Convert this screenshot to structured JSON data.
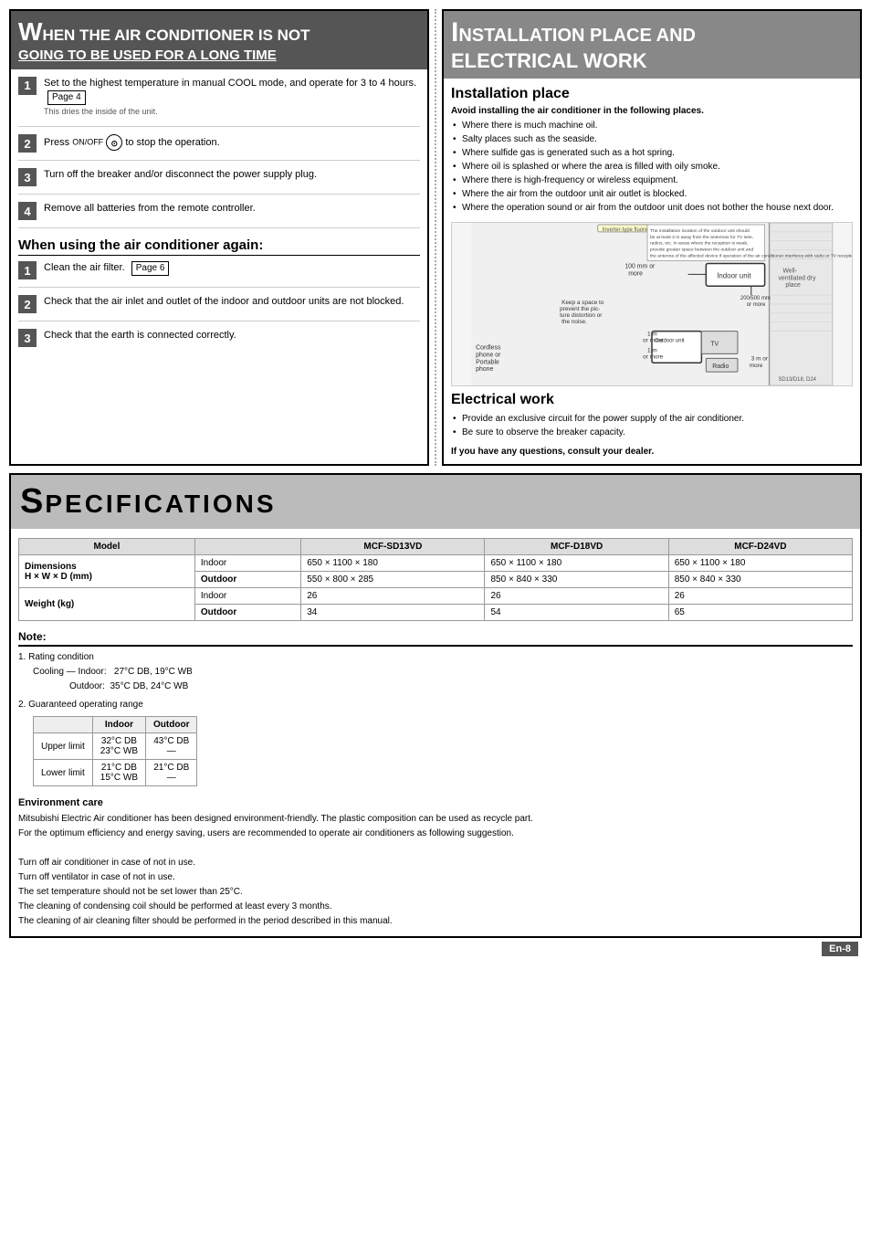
{
  "left_panel": {
    "title_big": "W",
    "title_text": "HEN THE AIR CONDITIONER IS NOT",
    "title_underline": "GOING TO BE USED FOR A LONG TIME",
    "steps": [
      {
        "num": "1",
        "text": "Set to the highest temperature in manual COOL mode, and operate for 3 to 4 hours.",
        "page_ref": "Page 4",
        "subtext": "This dries the inside of the unit."
      },
      {
        "num": "2",
        "text": "Press",
        "icon": "ON/OFF",
        "text2": "to stop the operation."
      },
      {
        "num": "3",
        "text": "Turn off the breaker and/or disconnect the power supply plug."
      },
      {
        "num": "4",
        "text": "Remove all batteries from the remote controller."
      }
    ],
    "reuse_title": "When using the air conditioner again:",
    "reuse_steps": [
      {
        "num": "1",
        "text": "Clean the air filter.",
        "page_ref": "Page 6"
      },
      {
        "num": "2",
        "text": "Check that the air inlet and outlet of the indoor and outdoor units are not blocked."
      },
      {
        "num": "3",
        "text": "Check that the earth is connected correctly."
      }
    ]
  },
  "right_panel": {
    "title_big": "I",
    "title_text": "NSTALLATION PLACE AND",
    "title_line2": "ELECTRICAL WORK",
    "install_title": "Installation place",
    "install_bold": "Avoid installing the air conditioner in the following places.",
    "install_bullets": [
      "Where there is much machine oil.",
      "Salty places such as the seaside.",
      "Where sulfide gas is generated such as a hot spring.",
      "Where oil is splashed or where the area is filled with oily smoke.",
      "Where there is high-frequency or wireless equipment.",
      "Where the air from the outdoor unit air outlet is blocked.",
      "Where the operation sound or air from the outdoor unit does not bother the house next door."
    ],
    "elec_title": "Electrical work",
    "elec_bullets": [
      "Provide an exclusive circuit for the power supply of the air conditioner.",
      "Be sure to observe the breaker capacity."
    ],
    "elec_note": "If you have any questions, consult your dealer."
  },
  "specs": {
    "title_big": "S",
    "title_text": "PECIFICATIONS",
    "table_headers": [
      "Model",
      "",
      "MCF-SD13VD",
      "MCF-D18VD",
      "MCF-D24VD"
    ],
    "rows": [
      {
        "label": "Dimensions",
        "sub1": "Indoor",
        "sub2": "Outdoor",
        "vals_indoor": [
          "650 × 1100 × 180",
          "650 × 1100 × 180",
          "650 × 1100 × 180"
        ],
        "vals_outdoor": [
          "550 × 800 × 285",
          "850 × 840 × 330",
          "850 × 840 × 330"
        ]
      },
      {
        "label": "H × W × D (mm)",
        "sub1": "",
        "sub2": ""
      },
      {
        "label": "Weight (kg)",
        "sub1": "Indoor",
        "sub2": "Outdoor",
        "vals_indoor": [
          "26",
          "26",
          "26"
        ],
        "vals_outdoor": [
          "34",
          "54",
          "65"
        ]
      }
    ],
    "note_title": "Note:",
    "note_items": [
      {
        "num": "1",
        "text": "Rating condition",
        "details": [
          "Cooling — Indoor:   27°C DB, 19°C WB",
          "             Outdoor:  35°C DB, 24°C WB"
        ]
      },
      {
        "num": "2",
        "text": "Guaranteed operating range"
      }
    ],
    "operating_table": {
      "headers": [
        "",
        "Indoor",
        "Outdoor"
      ],
      "rows": [
        {
          "label": "Upper limit",
          "indoor": "32°C DB\n23°C WB",
          "outdoor": "43°C DB\n—"
        },
        {
          "label": "Lower limit",
          "indoor": "21°C DB\n15°C WB",
          "outdoor": "21°C DB\n—"
        }
      ]
    },
    "env_title": "Environment care",
    "env_lines": [
      "Mitsubishi Electric Air conditioner has been designed environment-friendly. The plastic composition can be used as recycle part.",
      "For the optimum efficiency and energy saving, users are recommended to operate air conditioners as following suggestion.",
      "",
      "Turn off air conditioner in case of not in use.",
      "Turn off ventilator in case of not in use.",
      "The set temperature should not be set lower than 25°C.",
      "The cleaning of condensing coil should be performed at least every 3 months.",
      "The cleaning of air cleaning filter should be performed in the period described in this manual."
    ]
  },
  "page_number": "En-8"
}
